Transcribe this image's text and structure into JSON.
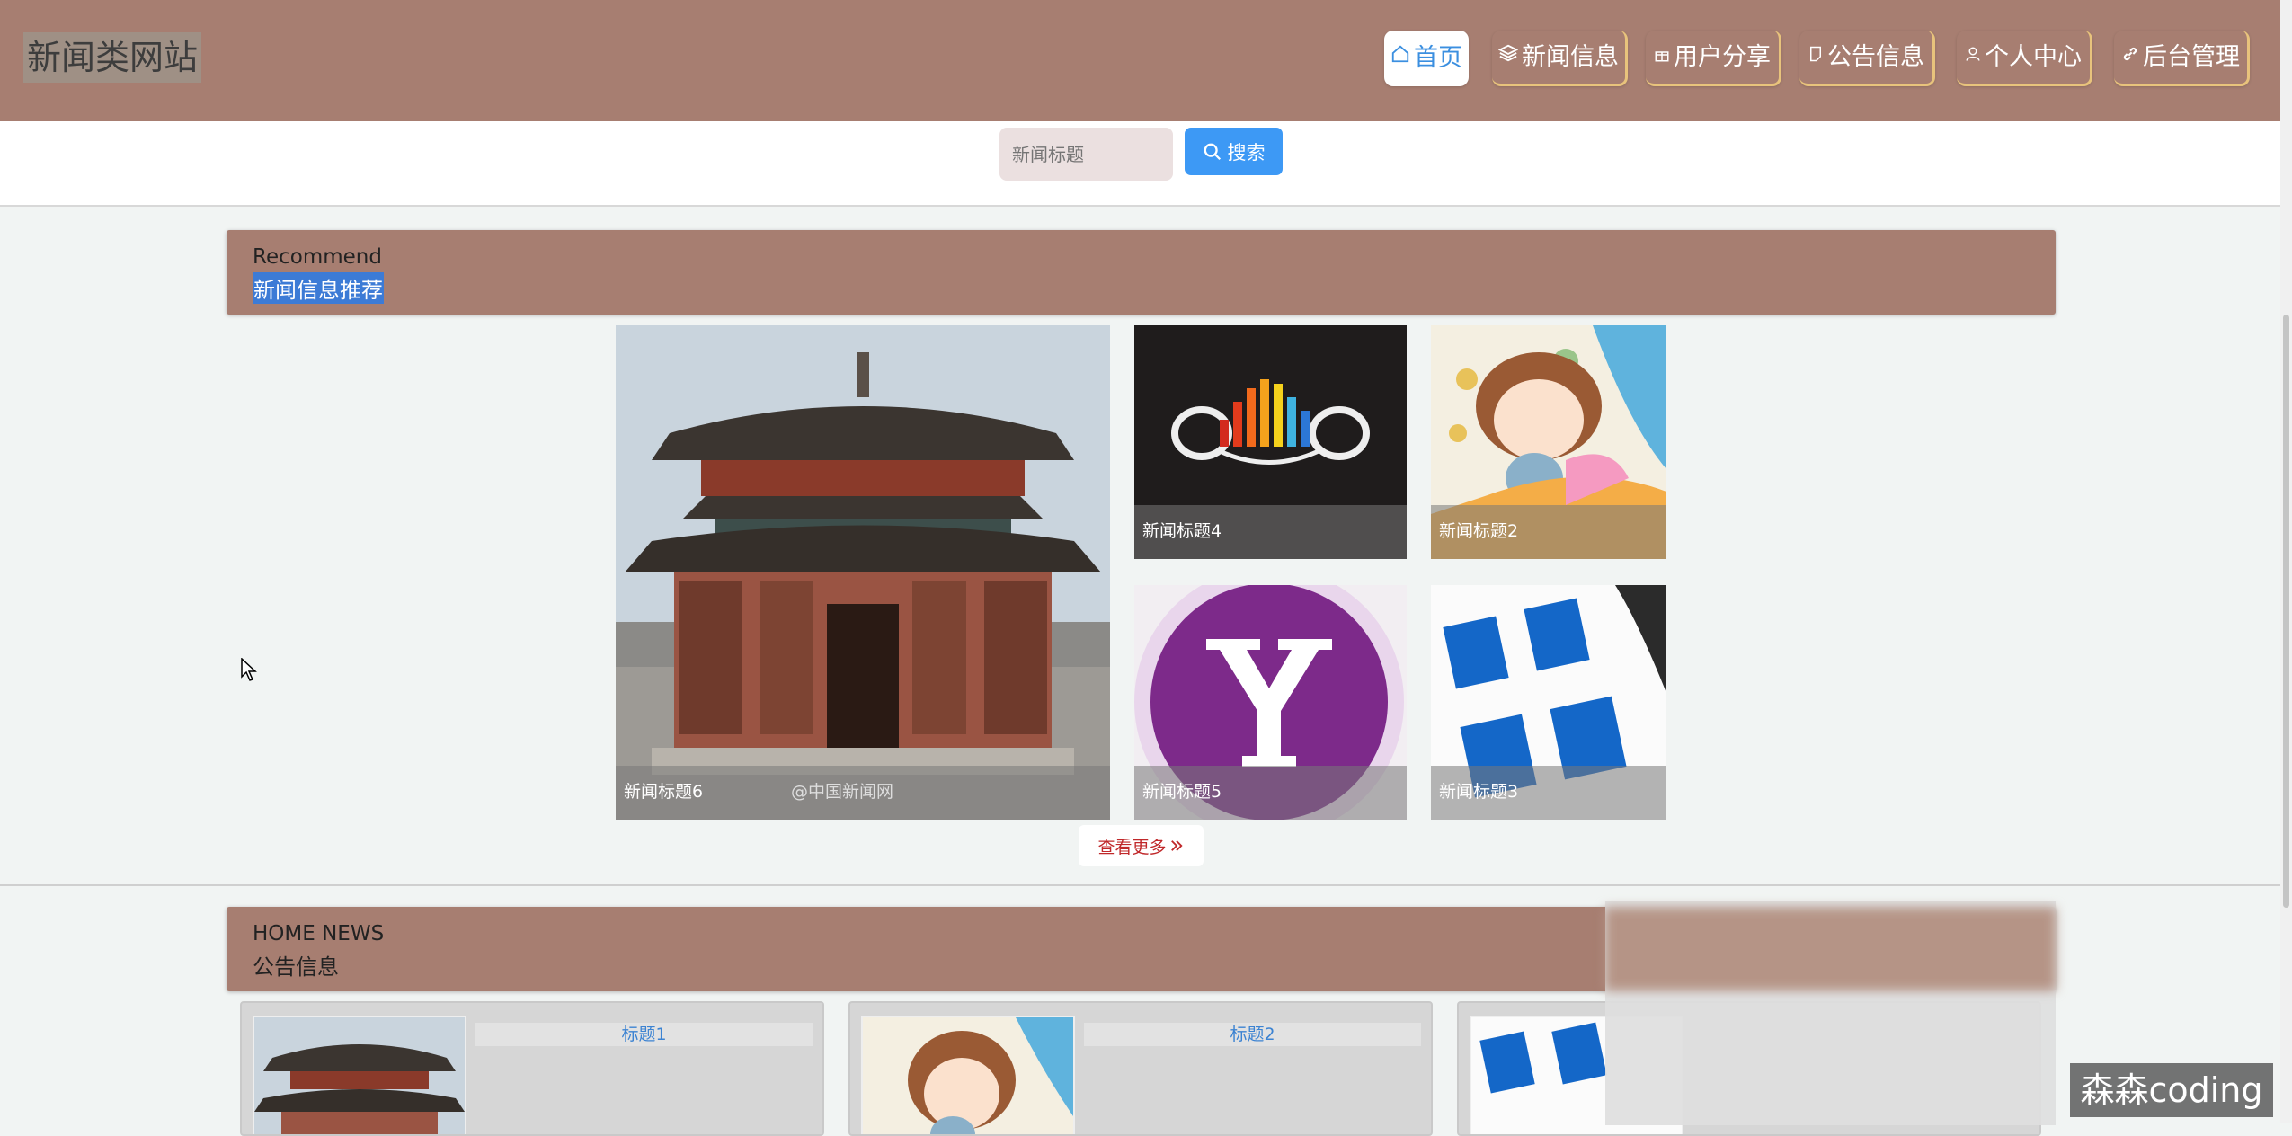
{
  "header": {
    "site_title": "新闻类网站",
    "nav": [
      {
        "label": "首页",
        "icon": "home-icon"
      },
      {
        "label": "新闻信息",
        "icon": "layers-icon"
      },
      {
        "label": "用户分享",
        "icon": "gift-icon"
      },
      {
        "label": "公告信息",
        "icon": "note-icon"
      },
      {
        "label": "个人中心",
        "icon": "user-icon"
      },
      {
        "label": "后台管理",
        "icon": "link-icon"
      }
    ]
  },
  "search": {
    "placeholder": "新闻标题",
    "button_label": "搜索"
  },
  "recommend": {
    "heading_en": "Recommend",
    "heading_cn": "新闻信息推荐",
    "tiles": [
      {
        "caption": "新闻标题6",
        "image_watermark": "@中国新闻网"
      },
      {
        "caption": "新闻标题4"
      },
      {
        "caption": "新闻标题2"
      },
      {
        "caption": "新闻标题5"
      },
      {
        "caption": "新闻标题3"
      }
    ],
    "more_label": "查看更多"
  },
  "notices": {
    "heading_en": "HOME NEWS",
    "heading_cn": "公告信息",
    "cards": [
      {
        "title": "标题1"
      },
      {
        "title": "标题2"
      }
    ]
  },
  "watermark": "森森coding",
  "colors": {
    "header_bg": "#a77e71",
    "accent": "#3d99f5",
    "nav_border": "#e8c37c",
    "more_text": "#c0282a"
  }
}
